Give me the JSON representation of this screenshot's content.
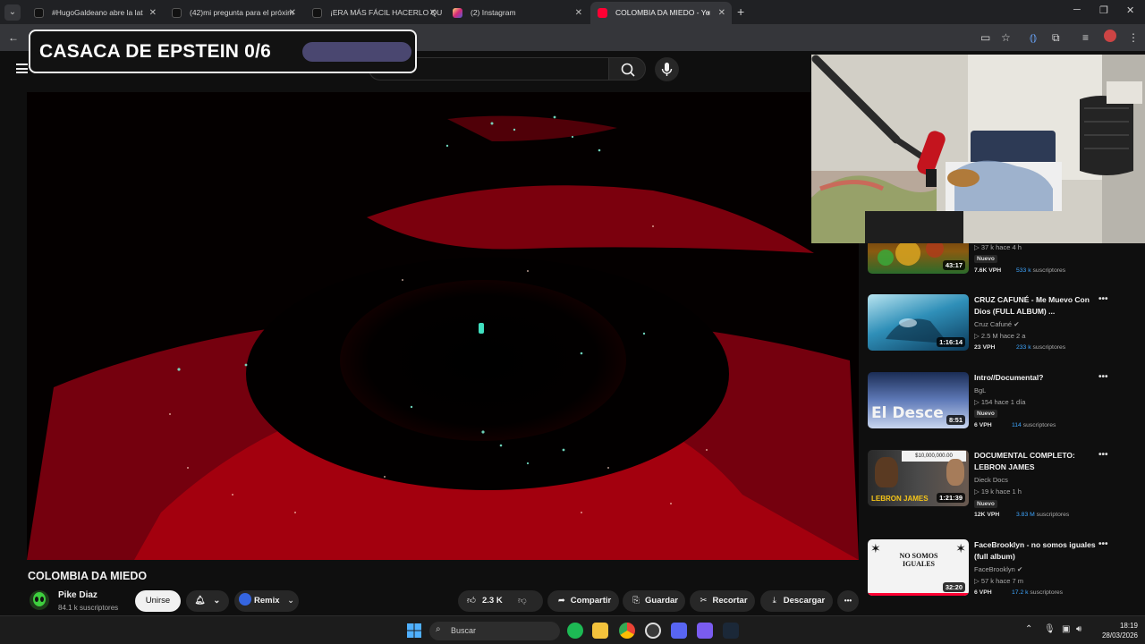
{
  "browser": {
    "tabs": [
      {
        "label": "#HugoGaldeano abre la lat",
        "favicon": "tiktok-icon"
      },
      {
        "label": "(42)mi pregunta para el próxim",
        "favicon": "tiktok-icon"
      },
      {
        "label": "¡ERA MÁS FÁCIL HACERLO QUE",
        "favicon": "tiktok-icon"
      },
      {
        "label": "(2) Instagram",
        "favicon": "instagram-icon"
      },
      {
        "label": "COLOMBIA DA MIEDO - Yo",
        "favicon": "youtube-icon",
        "active": true
      }
    ],
    "close_glyph": "✕",
    "new_tab_glyph": "+"
  },
  "overlay": {
    "text": "CASACA DE EPSTEIN 0/6"
  },
  "video": {
    "title": "COLOMBIA DA MIEDO",
    "channel": "Pike Diaz",
    "subscribers": "84.1 k suscriptores",
    "buttons": {
      "join": "Unirse",
      "remix": "Remix",
      "likes": "2.3 K",
      "share": "Compartir",
      "save": "Guardar",
      "clip": "Recortar",
      "download": "Descargar",
      "more": "•••"
    }
  },
  "recommendations": [
    {
      "title": "",
      "channel": "",
      "meta": "▷ 37 k  hace 4 h",
      "duration": "43:17",
      "badge": "Nuevo",
      "vph": "7.6K VPH",
      "subs_value": "533 k",
      "subs_label": "suscriptores"
    },
    {
      "title": "CRUZ CAFUNÉ - Me Muevo Con Dios (FULL ALBUM) ...",
      "channel": "Cruz Cafuné",
      "meta": "▷ 2.5 M  hace 2 a",
      "duration": "1:16:14",
      "badge": "",
      "vph": "23 VPH",
      "subs_value": "233 k",
      "subs_label": "suscriptores"
    },
    {
      "title": "Intro//Documental?",
      "channel": "BgL",
      "meta": "▷ 154  hace 1 día",
      "duration": "8:51",
      "badge": "Nuevo",
      "vph": "6 VPH",
      "subs_value": "114",
      "subs_label": "suscriptores"
    },
    {
      "title": "DOCUMENTAL COMPLETO: LEBRON JAMES",
      "channel": "Dieck Docs",
      "meta": "▷ 19 k  hace 1 h",
      "duration": "1:21:39",
      "badge": "Nuevo",
      "vph": "12K VPH",
      "subs_value": "3.83 M",
      "subs_label": "suscriptores"
    },
    {
      "title": "FaceBrooklyn - no somos iguales (full album)",
      "channel": "FaceBrooklyn",
      "meta": "▷ 57 k  hace 7 m",
      "duration": "32:20",
      "badge": "",
      "vph": "6 VPH",
      "subs_value": "17.2 k",
      "subs_label": "suscriptores"
    }
  ],
  "thumb_text": {
    "intro": "El Desce",
    "lebron_price": "$10,000,000.00",
    "lebron_name": "LEBRON JAMES",
    "nosomos": "NO SOMOS IGUALES"
  },
  "taskbar": {
    "search_placeholder": "Buscar",
    "time": "18:19",
    "date": "28/03/2026"
  },
  "colors": {
    "accent_blue": "#3ea6ff",
    "youtube_red": "#ff0033",
    "overlay_bar": "#4a4770"
  }
}
